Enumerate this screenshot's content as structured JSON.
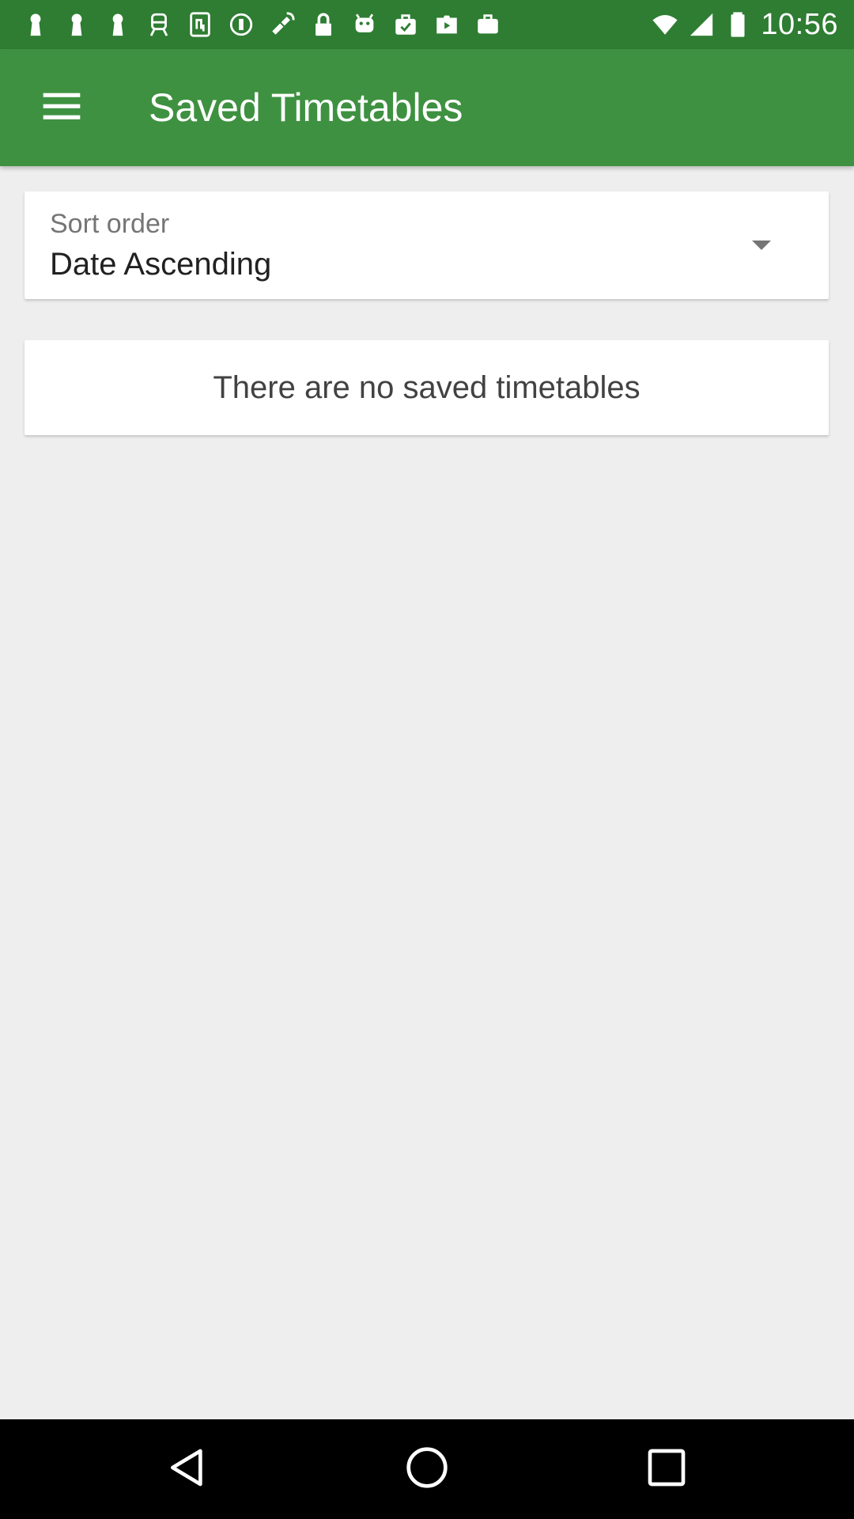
{
  "status_bar": {
    "time": "10:56",
    "left_icons": [
      "keyhole-icon",
      "keyhole-icon",
      "keyhole-icon",
      "train-icon",
      "transit-card-icon",
      "info-circle-icon",
      "fake-gps-icon",
      "lock-icon",
      "android-icon",
      "checked-bag-icon",
      "play-store-icon",
      "briefcase-icon"
    ],
    "right_icons": [
      "wifi-icon",
      "signal-icon",
      "battery-icon"
    ]
  },
  "app_bar": {
    "menu_icon": "hamburger-menu-icon",
    "title": "Saved Timetables",
    "background_color": "#3E9140"
  },
  "sort": {
    "label": "Sort order",
    "value": "Date Ascending",
    "arrow_icon": "dropdown-arrow-icon"
  },
  "empty_state": {
    "message": "There are no saved timetables"
  },
  "nav_bar": {
    "back_icon": "back-triangle-icon",
    "home_icon": "home-circle-icon",
    "recents_icon": "recents-square-icon"
  }
}
